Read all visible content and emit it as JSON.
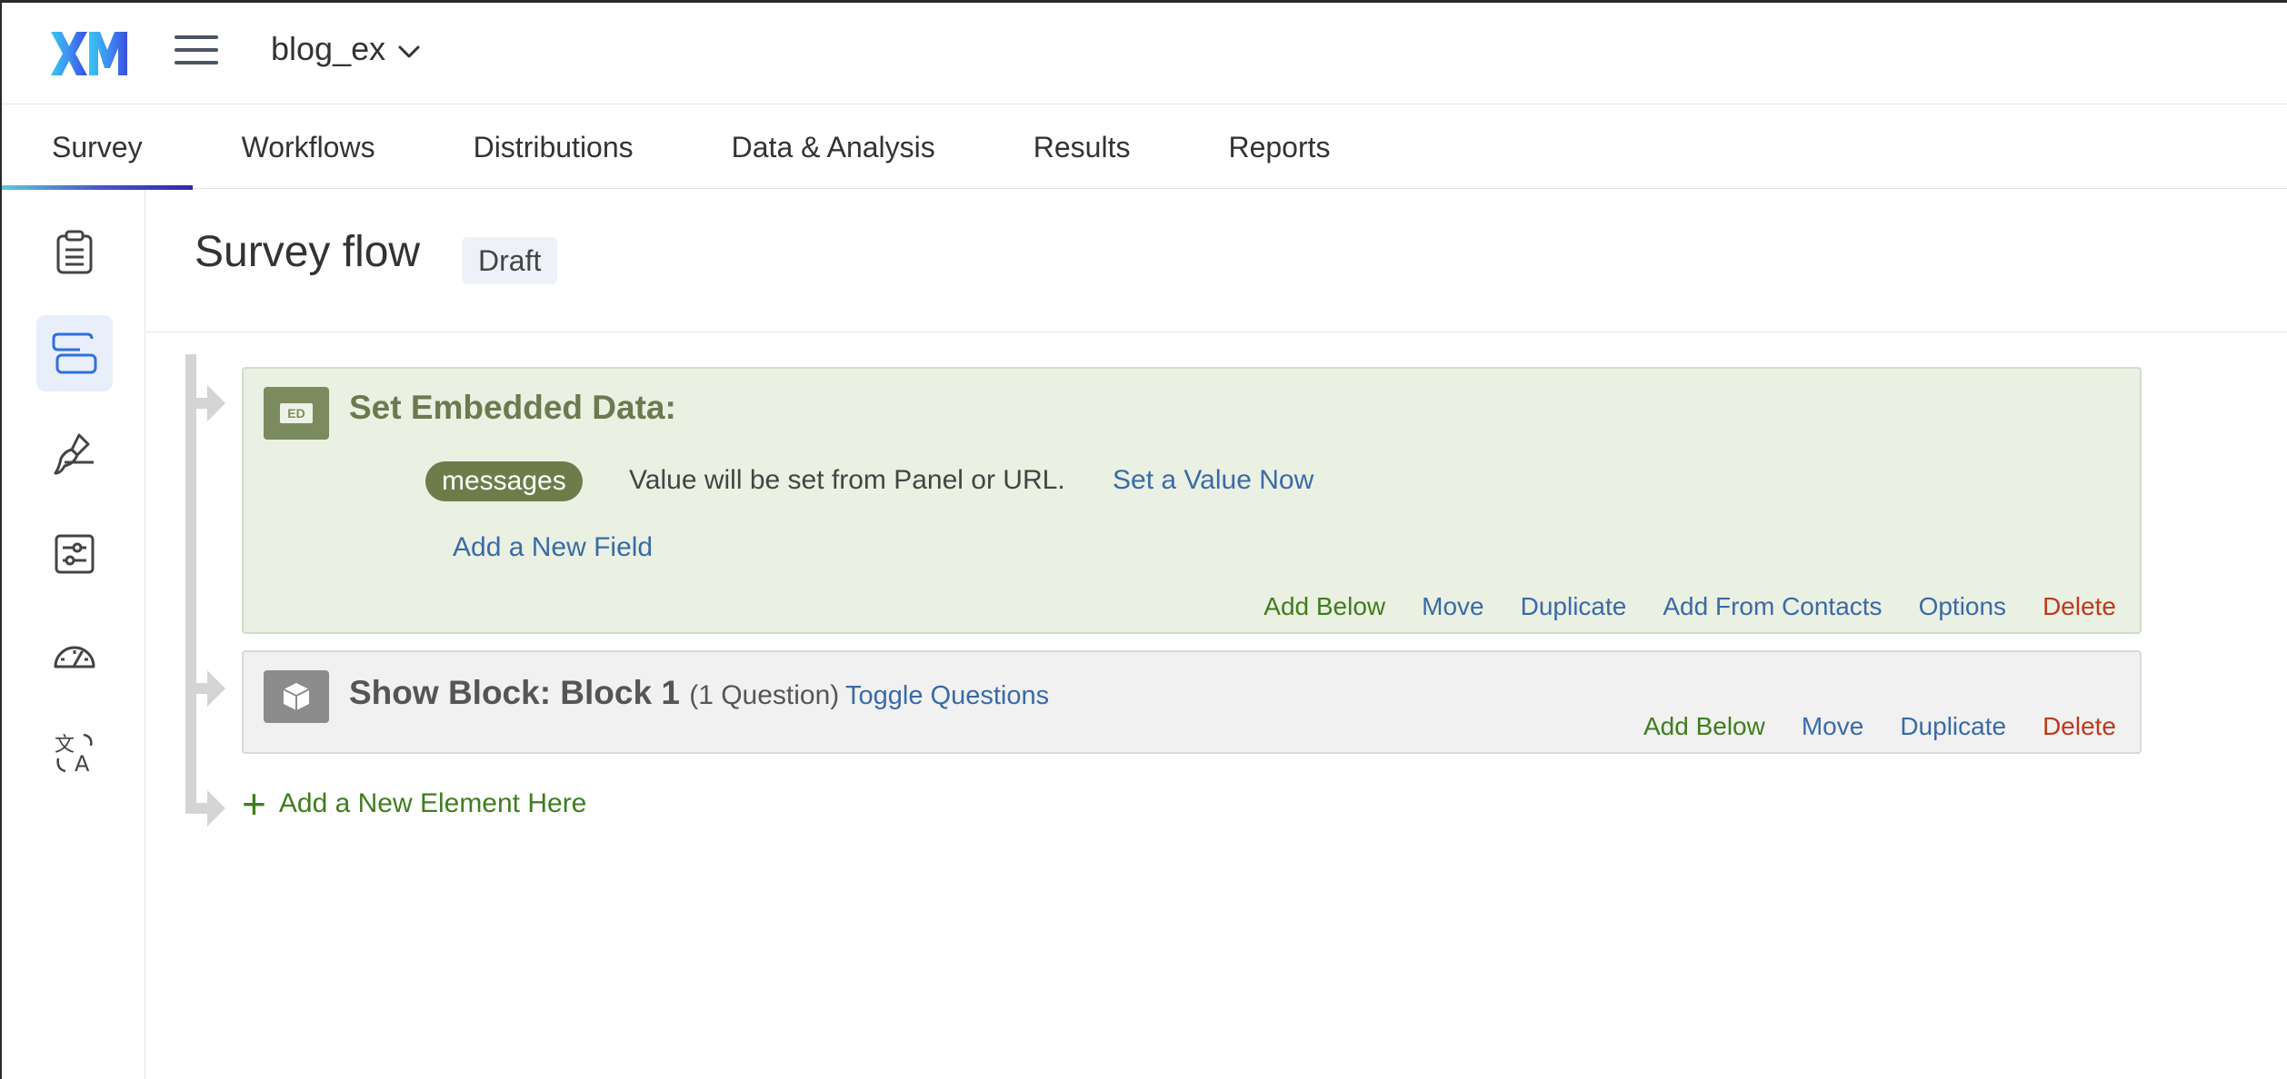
{
  "header": {
    "logo_text": "XM",
    "project_name": "blog_ex"
  },
  "tabs": [
    {
      "label": "Survey",
      "active": true
    },
    {
      "label": "Workflows"
    },
    {
      "label": "Distributions"
    },
    {
      "label": "Data & Analysis"
    },
    {
      "label": "Results"
    },
    {
      "label": "Reports"
    }
  ],
  "sidebar": {
    "items": [
      {
        "icon": "clipboard-icon"
      },
      {
        "icon": "survey-flow-icon",
        "active": true
      },
      {
        "icon": "brush-icon"
      },
      {
        "icon": "survey-options-icon"
      },
      {
        "icon": "gauge-icon"
      },
      {
        "icon": "translate-icon"
      }
    ]
  },
  "page": {
    "title": "Survey flow",
    "status": "Draft"
  },
  "flow": {
    "embedded_data": {
      "icon_label": "ED",
      "title": "Set Embedded Data:",
      "field_name": "messages",
      "field_note": "Value will be set from Panel or URL.",
      "set_value_link": "Set a Value Now",
      "add_field_link": "Add a New Field",
      "actions": {
        "add_below": "Add Below",
        "move": "Move",
        "duplicate": "Duplicate",
        "add_from_contacts": "Add From Contacts",
        "options": "Options",
        "delete": "Delete"
      }
    },
    "block": {
      "title": "Show Block: Block 1",
      "question_count": "(1 Question)",
      "toggle_link": "Toggle Questions",
      "actions": {
        "add_below": "Add Below",
        "move": "Move",
        "duplicate": "Duplicate",
        "delete": "Delete"
      }
    },
    "add_element": "Add a New Element Here"
  },
  "colors": {
    "embedded_card_bg": "#eaf0e2",
    "block_card_bg": "#f1f1f1",
    "action_green": "#3f7d1e",
    "action_blue": "#3a6aa8",
    "action_red": "#c0391b",
    "tab_underline": "#4a57c8"
  }
}
